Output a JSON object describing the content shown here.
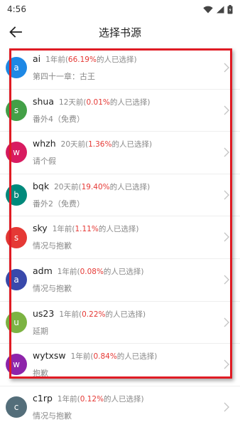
{
  "status_bar": {
    "time": "4:56"
  },
  "header": {
    "title": "选择书源"
  },
  "sources": [
    {
      "letter": "a",
      "name": "ai",
      "time": "1年前(",
      "percent": "66.19%",
      "suffix": "的人已选择)",
      "chapter": "第四十一章：古王",
      "color": "#1e88e5"
    },
    {
      "letter": "s",
      "name": "shua",
      "time": "12天前(",
      "percent": "0.01%",
      "suffix": "的人已选择)",
      "chapter": "番外4（免费）",
      "color": "#43a047"
    },
    {
      "letter": "w",
      "name": "whzh",
      "time": "20天前(",
      "percent": "1.36%",
      "suffix": "的人已选择)",
      "chapter": "请个假",
      "color": "#d81b60"
    },
    {
      "letter": "b",
      "name": "bqk",
      "time": "20天前(",
      "percent": "19.40%",
      "suffix": "的人已选择)",
      "chapter": "番外2（免费）",
      "color": "#00897b"
    },
    {
      "letter": "s",
      "name": "sky",
      "time": "1年前(",
      "percent": "1.11%",
      "suffix": "的人已选择)",
      "chapter": "情况与抱歉",
      "color": "#e53935"
    },
    {
      "letter": "a",
      "name": "adm",
      "time": "1年前(",
      "percent": "0.08%",
      "suffix": "的人已选择)",
      "chapter": "情况与抱歉",
      "color": "#3949ab"
    },
    {
      "letter": "u",
      "name": "us23",
      "time": "1年前(",
      "percent": "0.22%",
      "suffix": "的人已选择)",
      "chapter": "延期",
      "color": "#7cb342"
    },
    {
      "letter": "w",
      "name": "wytxsw",
      "time": "1年前(",
      "percent": "0.84%",
      "suffix": "的人已选择)",
      "chapter": "抱歉",
      "color": "#8e24aa"
    },
    {
      "letter": "c",
      "name": "c1rp",
      "time": "1年前(",
      "percent": "0.12%",
      "suffix": "的人已选择)",
      "chapter": "情况与抱歉",
      "color": "#546e7a"
    }
  ]
}
